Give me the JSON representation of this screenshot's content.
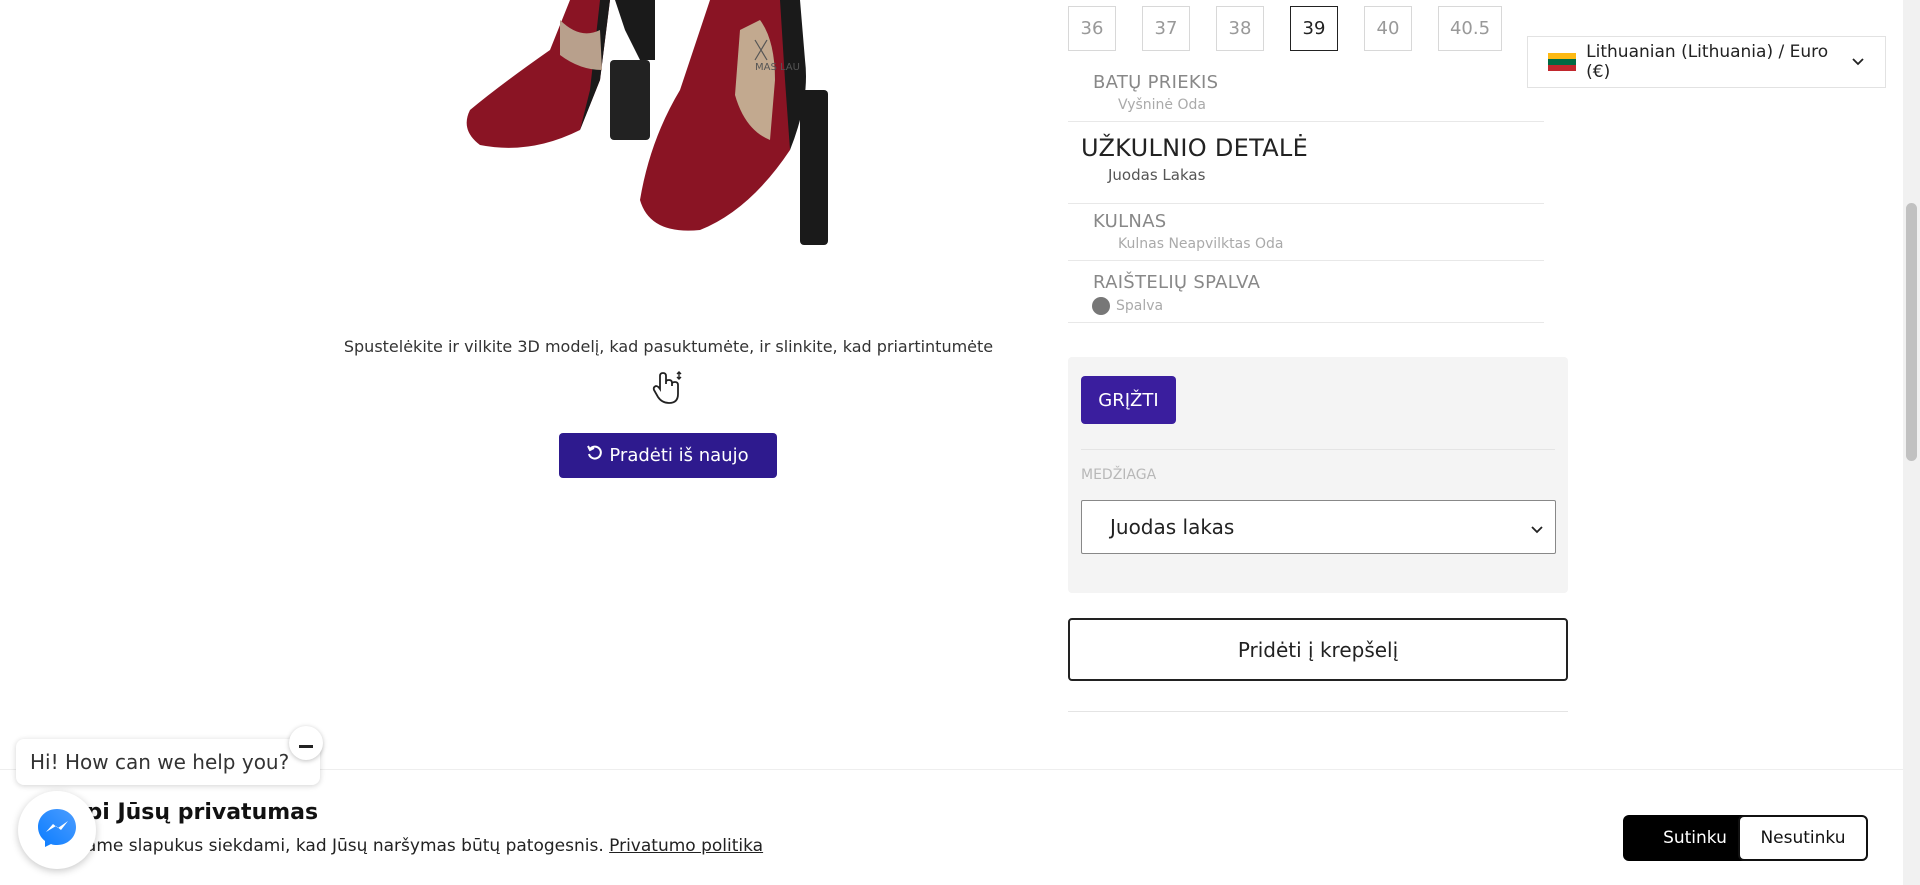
{
  "product_view": {
    "instruction": "Spustelėkite ir vilkite 3D modelį, kad pasuktumėte, ir slinkite, kad priartintumėte",
    "restart_label": "Pradėti iš naujo",
    "model_logo_text": "MAS LAU"
  },
  "sizes": [
    {
      "label": "36",
      "selected": false
    },
    {
      "label": "37",
      "selected": false
    },
    {
      "label": "38",
      "selected": false
    },
    {
      "label": "39",
      "selected": true
    },
    {
      "label": "40",
      "selected": false
    },
    {
      "label": "40.5",
      "selected": false
    }
  ],
  "currency": {
    "label": "Lithuanian (Lithuania) / Euro (€)",
    "flag_colors": [
      "#fdb913",
      "#006a44",
      "#c1272d"
    ]
  },
  "summary": [
    {
      "title": "BATŲ PRIEKIS",
      "value": "Vyšninė Oda",
      "active": false
    },
    {
      "title": "UŽKULNIO DETALĖ",
      "value": "Juodas Lakas",
      "active": true
    },
    {
      "title": "KULNAS",
      "value": "Kulnas Neapvilktas Oda",
      "active": false
    },
    {
      "title": "RAIŠTELIŲ SPALVA",
      "value": "Spalva",
      "active": false
    }
  ],
  "panel": {
    "back_label": "GRĮŽTI",
    "material_label": "MEDŽIAGA",
    "material_value": "Juodas lakas"
  },
  "add_to_cart_label": "Pridėti į krepšelį",
  "cookie": {
    "title": "rūpi Jūsų privatumas",
    "text": "dojame slapukus siekdami, kad Jūsų naršymas būtų patogesnis.",
    "link": "Privatumo politika",
    "accept": "Sutinku",
    "decline": "Nesutinku"
  },
  "chat": {
    "greeting": "Hi! How can we help you?"
  },
  "colors": {
    "accent": "#3a1e9e",
    "shoe_red": "#8a1424",
    "shoe_black": "#1a1a1a"
  }
}
